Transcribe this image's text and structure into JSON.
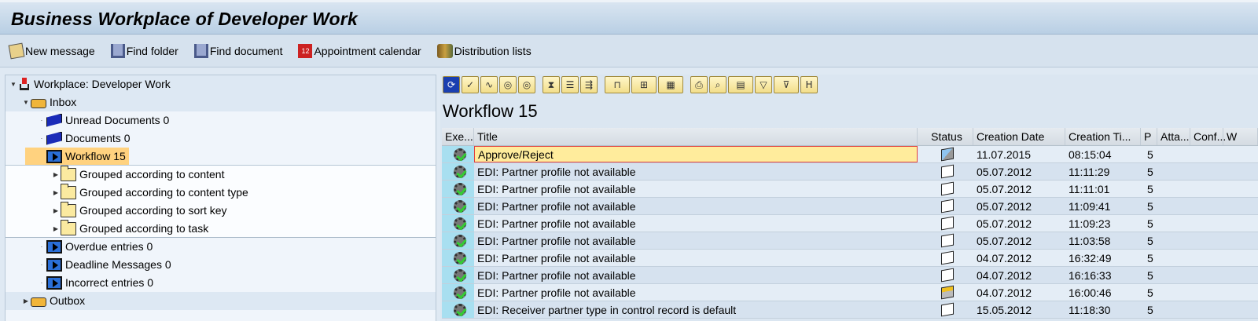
{
  "window": {
    "title": "Business Workplace of Developer Work"
  },
  "appbar": [
    {
      "label": "New message",
      "icon": "new-message-icon"
    },
    {
      "label": "Find folder",
      "icon": "binoculars-icon"
    },
    {
      "label": "Find document",
      "icon": "binoculars-icon"
    },
    {
      "label": "Appointment calendar",
      "icon": "calendar-icon",
      "icon_text": "12"
    },
    {
      "label": "Distribution lists",
      "icon": "distribution-list-icon"
    }
  ],
  "tree": {
    "root": "Workplace: Developer Work",
    "inbox": "Inbox",
    "items": [
      {
        "label": "Unread Documents 0"
      },
      {
        "label": "Documents 0"
      },
      {
        "label": "Workflow 15"
      }
    ],
    "groups": [
      {
        "label": "Grouped according to content"
      },
      {
        "label": "Grouped according to content type"
      },
      {
        "label": "Grouped according to sort key"
      },
      {
        "label": "Grouped according to task"
      }
    ],
    "more": [
      {
        "label": "Overdue entries 0"
      },
      {
        "label": "Deadline Messages 0"
      },
      {
        "label": "Incorrect entries 0"
      }
    ],
    "outbox": "Outbox"
  },
  "main": {
    "title": "Workflow 15",
    "toolbar": [
      "refresh",
      "execute",
      "workflow-log",
      "display",
      "display-alt",
      "hourglass",
      "details",
      "forward",
      "attachments",
      "create-attachment",
      "layout",
      "print",
      "find",
      "select-layout",
      "sort",
      "filter",
      "binoculars"
    ],
    "columns": [
      "Exe...",
      "Title",
      "Status",
      "Creation Date",
      "Creation Ti...",
      "P",
      "Atta...",
      "Conf...",
      "W"
    ],
    "rows": [
      {
        "title": "Approve/Reject",
        "status": "started",
        "date": "11.07.2015",
        "time": "08:15:04",
        "p": "5"
      },
      {
        "title": "EDI: Partner profile not available",
        "status": "ready",
        "date": "05.07.2012",
        "time": "11:11:29",
        "p": "5"
      },
      {
        "title": "EDI: Partner profile not available",
        "status": "ready",
        "date": "05.07.2012",
        "time": "11:11:01",
        "p": "5"
      },
      {
        "title": "EDI: Partner profile not available",
        "status": "ready",
        "date": "05.07.2012",
        "time": "11:09:41",
        "p": "5"
      },
      {
        "title": "EDI: Partner profile not available",
        "status": "ready",
        "date": "05.07.2012",
        "time": "11:09:23",
        "p": "5"
      },
      {
        "title": "EDI: Partner profile not available",
        "status": "ready",
        "date": "05.07.2012",
        "time": "11:03:58",
        "p": "5"
      },
      {
        "title": "EDI: Partner profile not available",
        "status": "ready",
        "date": "04.07.2012",
        "time": "16:32:49",
        "p": "5"
      },
      {
        "title": "EDI: Partner profile not available",
        "status": "ready",
        "date": "04.07.2012",
        "time": "16:16:33",
        "p": "5"
      },
      {
        "title": "EDI: Partner profile not available",
        "status": "reserved",
        "date": "04.07.2012",
        "time": "16:00:46",
        "p": "5"
      },
      {
        "title": "EDI: Receiver partner type in control record is default",
        "status": "ready",
        "date": "15.05.2012",
        "time": "11:18:30",
        "p": "5"
      }
    ]
  }
}
